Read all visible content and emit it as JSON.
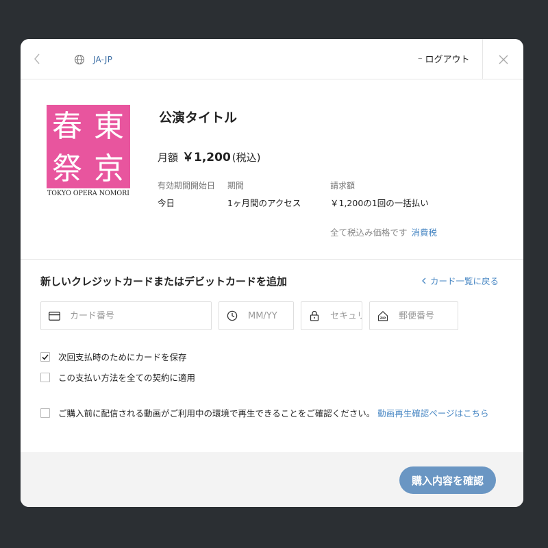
{
  "header": {
    "language": "JA-JP",
    "logout_label": "ログアウト"
  },
  "event": {
    "title": "公演タイトル",
    "price_prefix": "月額",
    "price": "￥1,200",
    "price_tax": "(税込)",
    "info": {
      "start_label": "有効期間開始日",
      "start_value": "今日",
      "period_label": "期間",
      "period_value": "1ヶ月間のアクセス",
      "billing_label": "請求額",
      "billing_value": "￥1,200の1回の一括払い"
    },
    "tax_note": "全て税込み価格です",
    "tax_link": "消費税"
  },
  "logo": {
    "kanji": [
      "春",
      "東",
      "祭",
      "京"
    ],
    "caption": "TOKYO OPERA NOMORI",
    "color": "#e8559e"
  },
  "card_form": {
    "title": "新しいクレジットカードまたはデビットカードを追加",
    "back_link": "カード一覧に戻る",
    "card_number_placeholder": "カード番号",
    "expiry_placeholder": "MM/YY",
    "security_placeholder": "セキュリティコード",
    "zip_placeholder": "郵便番号"
  },
  "options": {
    "save_card_label": "次回支払時のためにカードを保存",
    "save_card_checked": true,
    "apply_all_label": "この支払い方法を全ての契約に適用",
    "apply_all_checked": false
  },
  "confirmation": {
    "text": "ご購入前に配信される動画がご利用中の環境で再生できることをご確認ください。",
    "link": "動画再生確認ページはこちら"
  },
  "footer": {
    "submit_label": "購入内容を確認"
  },
  "colors": {
    "accent": "#4a88c4",
    "button": "#6a96c3",
    "backdrop": "#2b2f33"
  }
}
